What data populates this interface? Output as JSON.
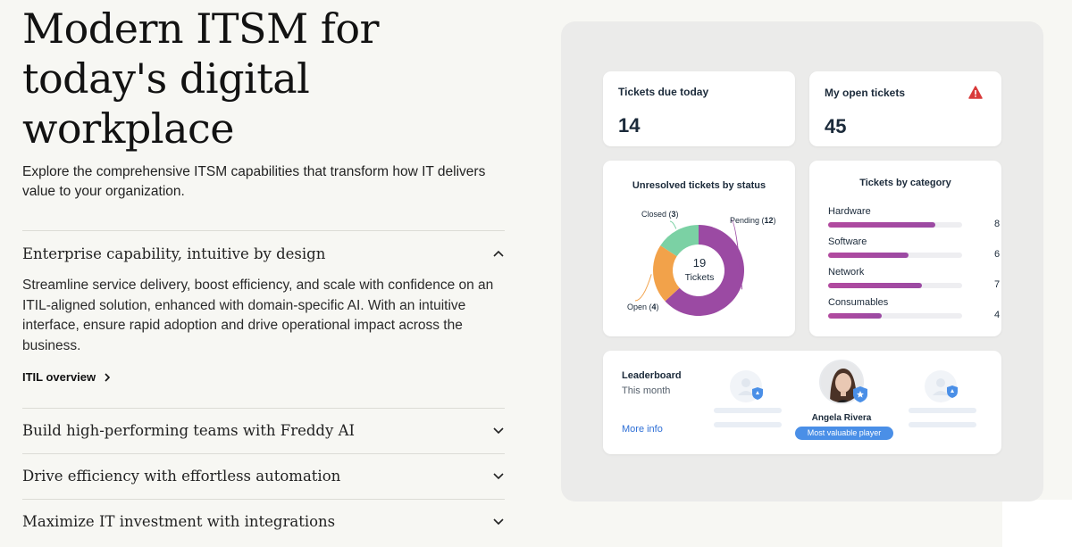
{
  "hero": {
    "title_line1": "Modern ITSM for",
    "title_line2": "today's digital",
    "title_line3": "workplace",
    "subtitle": "Explore the comprehensive ITSM capabilities that transform how IT delivers value to your organization."
  },
  "accordion": [
    {
      "title": "Enterprise capability, intuitive by design",
      "expanded": true,
      "body": "Streamline service delivery, boost efficiency, and scale with confidence on an ITIL-aligned solution, enhanced with domain-specific AI. With an intuitive interface, ensure rapid adoption and drive operational impact across the business.",
      "link": "ITIL overview"
    },
    {
      "title": "Build high-performing teams with Freddy AI",
      "expanded": false
    },
    {
      "title": "Drive efficiency with effortless automation",
      "expanded": false
    },
    {
      "title": "Maximize IT investment with integrations",
      "expanded": false
    }
  ],
  "dashboard": {
    "due_today": {
      "label": "Tickets due today",
      "value": "14"
    },
    "open_tickets": {
      "label": "My open tickets",
      "value": "45",
      "icon": "warning-icon",
      "icon_color": "#d93a3a"
    },
    "status_chart": {
      "title": "Unresolved tickets by status",
      "center_value": "19",
      "center_label": "Tickets",
      "segments": [
        {
          "name": "Pending",
          "value": "12",
          "color": "#9b4aa3"
        },
        {
          "name": "Open",
          "value": "4",
          "color": "#f2a24a"
        },
        {
          "name": "Closed",
          "value": "3",
          "color": "#7bd1a4"
        }
      ]
    },
    "category_chart": {
      "title": "Tickets by category",
      "max": 10,
      "items": [
        {
          "name": "Hardware",
          "value": "8"
        },
        {
          "name": "Software",
          "value": "6"
        },
        {
          "name": "Network",
          "value": "7"
        },
        {
          "name": "Consumables",
          "value": "4"
        }
      ]
    },
    "leaderboard": {
      "title": "Leaderboard",
      "period": "This month",
      "link": "More info",
      "winner_name": "Angela Rivera",
      "winner_badge": "Most valuable player"
    }
  },
  "colors": {
    "accent_blue": "#2e6fd6",
    "purple": "#9b4aa3",
    "badge_blue": "#4a8fe7"
  }
}
